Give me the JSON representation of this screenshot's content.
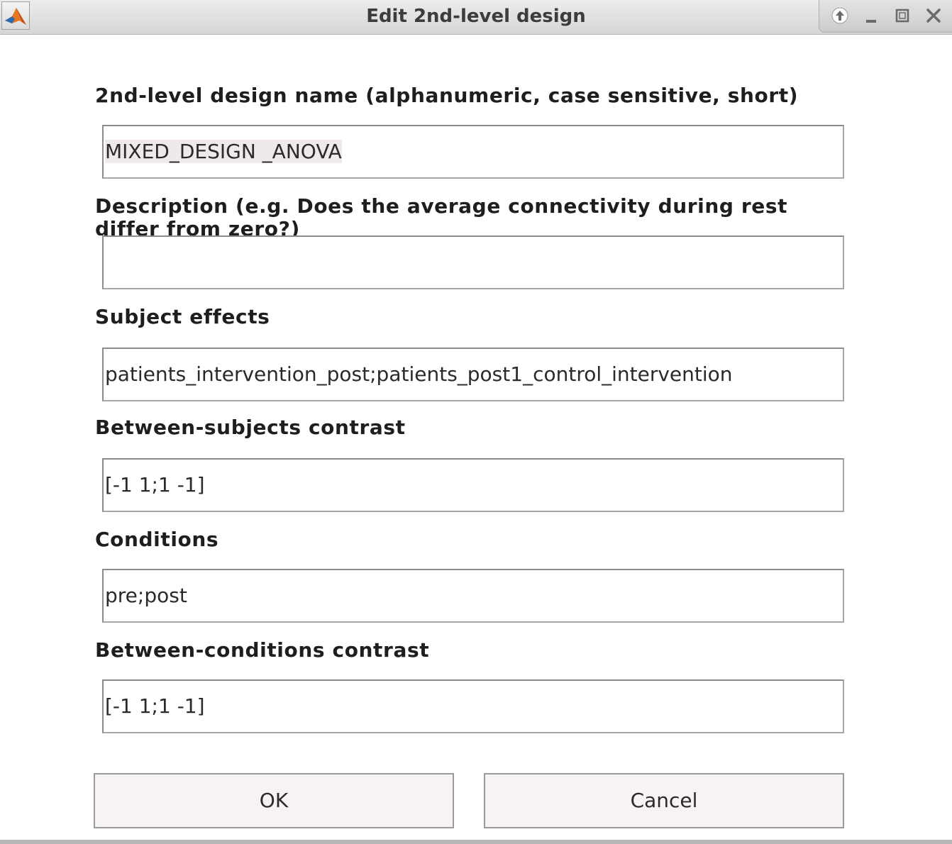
{
  "window": {
    "title": "Edit 2nd-level design",
    "app_icon": "matlab-logo-icon",
    "controls": [
      "shade-up-icon",
      "minimize-icon",
      "maximize-icon",
      "close-icon"
    ]
  },
  "fields": {
    "name": {
      "label": "2nd-level design name (alphanumeric, case sensitive, short)",
      "value": "MIXED_DESIGN _ANOVA"
    },
    "description": {
      "label": "Description (e.g. Does the average connectivity during rest differ from zero?)",
      "value": ""
    },
    "subject_effects": {
      "label": "Subject effects",
      "value": "patients_intervention_post;patients_post1_control_intervention"
    },
    "between_subjects_contrast": {
      "label": "Between-subjects contrast",
      "value": "[-1 1;1 -1]"
    },
    "conditions": {
      "label": "Conditions",
      "value": "pre;post"
    },
    "between_conditions_contrast": {
      "label": "Between-conditions contrast",
      "value": "[-1 1;1 -1]"
    }
  },
  "buttons": {
    "ok_label": "OK",
    "cancel_label": "Cancel"
  }
}
